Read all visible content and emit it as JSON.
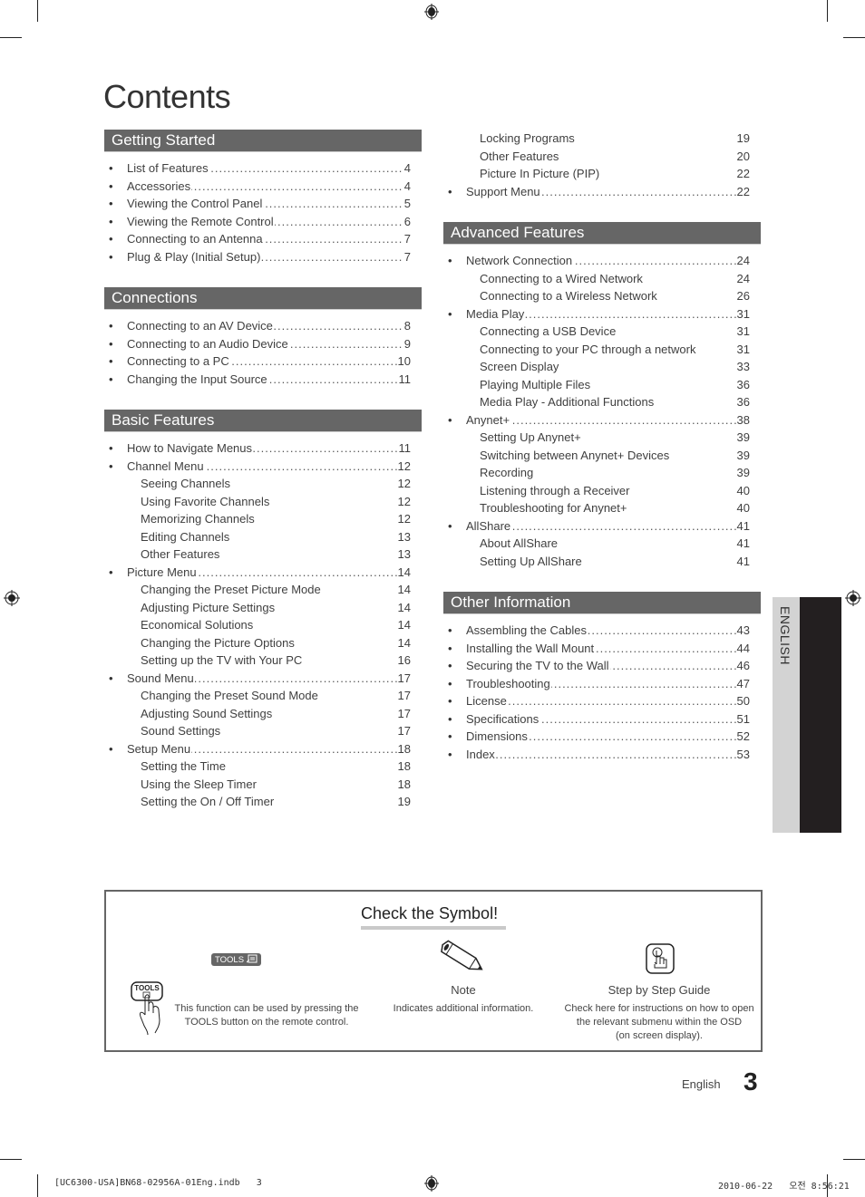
{
  "page": {
    "title": "Contents",
    "language_tab": "ENGLISH",
    "footer_language": "English",
    "page_number": "3"
  },
  "slug": {
    "file": "[UC6300-USA]BN68-02956A-01Eng.indb   3",
    "datetime": "2010-06-22   오전 8:56:21"
  },
  "left_column": [
    {
      "heading": "Getting Started",
      "entries": [
        {
          "level": "main",
          "label": "List of Features",
          "page": "4"
        },
        {
          "level": "main",
          "label": "Accessories",
          "page": "4"
        },
        {
          "level": "main",
          "label": "Viewing the Control Panel",
          "page": "5"
        },
        {
          "level": "main",
          "label": "Viewing the Remote Control",
          "page": "6"
        },
        {
          "level": "main",
          "label": "Connecting to an Antenna",
          "page": "7"
        },
        {
          "level": "main",
          "label": "Plug & Play (Initial Setup)",
          "page": "7"
        }
      ]
    },
    {
      "heading": "Connections",
      "entries": [
        {
          "level": "main",
          "label": "Connecting to an AV Device",
          "page": "8"
        },
        {
          "level": "main",
          "label": "Connecting to an Audio Device",
          "page": "9"
        },
        {
          "level": "main",
          "label": "Connecting to a PC",
          "page": "10"
        },
        {
          "level": "main",
          "label": "Changing the Input Source",
          "page": "11"
        }
      ]
    },
    {
      "heading": "Basic Features",
      "entries": [
        {
          "level": "main",
          "label": "How to Navigate Menus",
          "page": "11"
        },
        {
          "level": "main",
          "label": "Channel Menu",
          "page": "12"
        },
        {
          "level": "sub",
          "label": "Seeing Channels",
          "page": "12"
        },
        {
          "level": "sub",
          "label": "Using Favorite Channels",
          "page": "12"
        },
        {
          "level": "sub",
          "label": "Memorizing Channels",
          "page": "12"
        },
        {
          "level": "sub",
          "label": "Editing Channels",
          "page": "13"
        },
        {
          "level": "sub",
          "label": "Other Features",
          "page": "13"
        },
        {
          "level": "main",
          "label": "Picture Menu",
          "page": "14"
        },
        {
          "level": "sub",
          "label": "Changing the Preset Picture Mode",
          "page": "14"
        },
        {
          "level": "sub",
          "label": "Adjusting Picture Settings",
          "page": "14"
        },
        {
          "level": "sub",
          "label": "Economical Solutions",
          "page": "14"
        },
        {
          "level": "sub",
          "label": "Changing the Picture Options",
          "page": "14"
        },
        {
          "level": "sub",
          "label": "Setting up the TV with Your PC",
          "page": "16"
        },
        {
          "level": "main",
          "label": "Sound Menu",
          "page": "17"
        },
        {
          "level": "sub",
          "label": "Changing the Preset Sound Mode",
          "page": "17"
        },
        {
          "level": "sub",
          "label": "Adjusting Sound Settings",
          "page": "17"
        },
        {
          "level": "sub",
          "label": "Sound Settings",
          "page": "17"
        },
        {
          "level": "main",
          "label": "Setup Menu",
          "page": "18"
        },
        {
          "level": "sub",
          "label": "Setting the Time",
          "page": "18"
        },
        {
          "level": "sub",
          "label": "Using the Sleep Timer",
          "page": "18"
        },
        {
          "level": "sub",
          "label": "Setting the On / Off Timer",
          "page": "19"
        }
      ]
    }
  ],
  "right_column": [
    {
      "heading": "",
      "entries": [
        {
          "level": "sub",
          "label": "Locking Programs",
          "page": "19"
        },
        {
          "level": "sub",
          "label": "Other Features",
          "page": "20"
        },
        {
          "level": "sub",
          "label": "Picture In Picture (PIP)",
          "page": "22"
        },
        {
          "level": "main",
          "label": "Support Menu",
          "page": "22"
        }
      ]
    },
    {
      "heading": "Advanced Features",
      "entries": [
        {
          "level": "main",
          "label": "Network Connection",
          "page": "24"
        },
        {
          "level": "sub",
          "label": "Connecting to a Wired Network",
          "page": "24"
        },
        {
          "level": "sub",
          "label": "Connecting to a Wireless Network",
          "page": "26"
        },
        {
          "level": "main",
          "label": "Media Play",
          "page": "31"
        },
        {
          "level": "sub",
          "label": "Connecting a USB Device",
          "page": "31"
        },
        {
          "level": "sub",
          "label": "Connecting to your PC through a network",
          "page": "31"
        },
        {
          "level": "sub",
          "label": "Screen Display",
          "page": "33"
        },
        {
          "level": "sub",
          "label": "Playing Multiple Files",
          "page": "36"
        },
        {
          "level": "sub",
          "label": "Media Play - Additional Functions",
          "page": "36"
        },
        {
          "level": "main",
          "label": "Anynet+",
          "page": "38"
        },
        {
          "level": "sub",
          "label": "Setting Up Anynet+",
          "page": "39"
        },
        {
          "level": "sub",
          "label": "Switching between Anynet+ Devices",
          "page": "39"
        },
        {
          "level": "sub",
          "label": "Recording",
          "page": "39"
        },
        {
          "level": "sub",
          "label": "Listening through a Receiver",
          "page": "40"
        },
        {
          "level": "sub",
          "label": "Troubleshooting for Anynet+",
          "page": "40"
        },
        {
          "level": "main",
          "label": "AllShare",
          "page": "41"
        },
        {
          "level": "sub",
          "label": "About AllShare",
          "page": "41"
        },
        {
          "level": "sub",
          "label": "Setting Up AllShare",
          "page": "41"
        }
      ]
    },
    {
      "heading": "Other Information",
      "entries": [
        {
          "level": "main",
          "label": "Assembling the Cables",
          "page": "43"
        },
        {
          "level": "main",
          "label": "Installing the Wall Mount",
          "page": "44"
        },
        {
          "level": "main",
          "label": "Securing the TV to the Wall",
          "page": "46"
        },
        {
          "level": "main",
          "label": "Troubleshooting",
          "page": "47"
        },
        {
          "level": "main",
          "label": "License",
          "page": "50"
        },
        {
          "level": "main",
          "label": "Specifications",
          "page": "51"
        },
        {
          "level": "main",
          "label": "Dimensions",
          "page": "52"
        },
        {
          "level": "main",
          "label": "Index",
          "page": "53"
        }
      ]
    }
  ],
  "symbols": {
    "title": "Check the Symbol!",
    "tools": {
      "badge": "TOOLS",
      "button_label": "TOOLS",
      "desc_line1": "This function can be used by pressing the",
      "desc_line2": "TOOLS button on the remote control.",
      "icon": "hand-pressing-tools-button-icon"
    },
    "note": {
      "label": "Note",
      "desc": "Indicates additional information.",
      "icon": "pencil-icon"
    },
    "guide": {
      "label": "Step by Step Guide",
      "desc_line1": "Check here for instructions on how to open",
      "desc_line2": "the relevant submenu within the OSD",
      "desc_line3": "(on screen display).",
      "icon": "finger-press-icon"
    }
  },
  "colors": {
    "section_header_bg": "#666666",
    "side_tab_light": "#d3d3d3",
    "side_tab_dark": "#231f20"
  }
}
